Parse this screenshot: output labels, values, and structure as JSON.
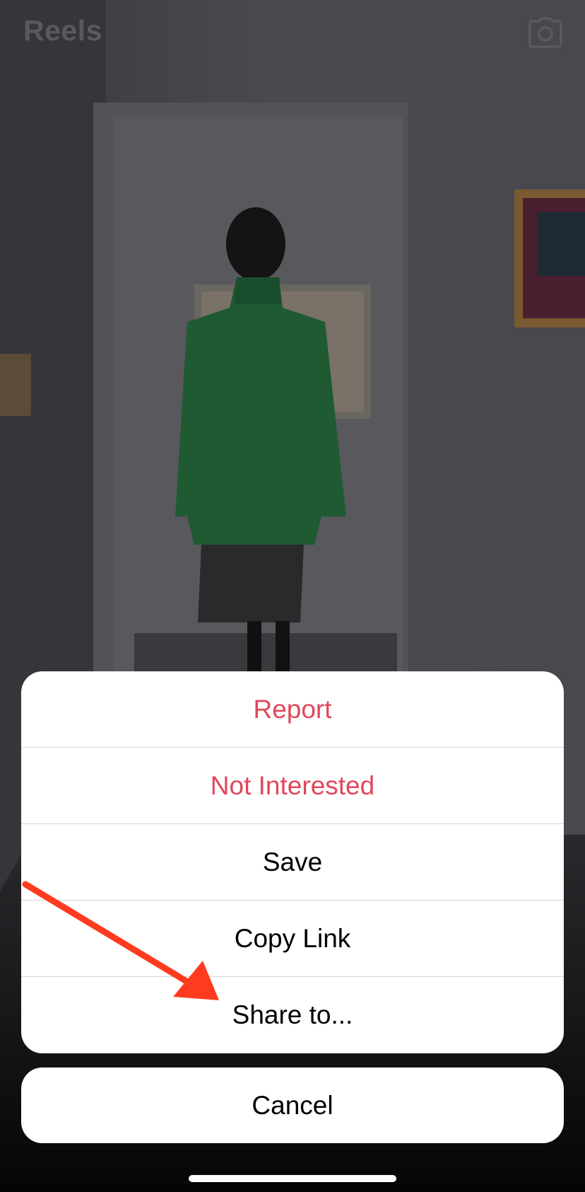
{
  "header": {
    "title": "Reels",
    "camera_icon": "camera-icon"
  },
  "action_sheet": {
    "items": [
      {
        "label": "Report",
        "style": "destructive"
      },
      {
        "label": "Not Interested",
        "style": "destructive"
      },
      {
        "label": "Save",
        "style": "default"
      },
      {
        "label": "Copy Link",
        "style": "default"
      },
      {
        "label": "Share to...",
        "style": "default"
      }
    ],
    "cancel_label": "Cancel"
  },
  "colors": {
    "destructive": "#e0475a",
    "annotation_arrow": "#ff3b1f",
    "sheet_bg": "#ffffff"
  }
}
